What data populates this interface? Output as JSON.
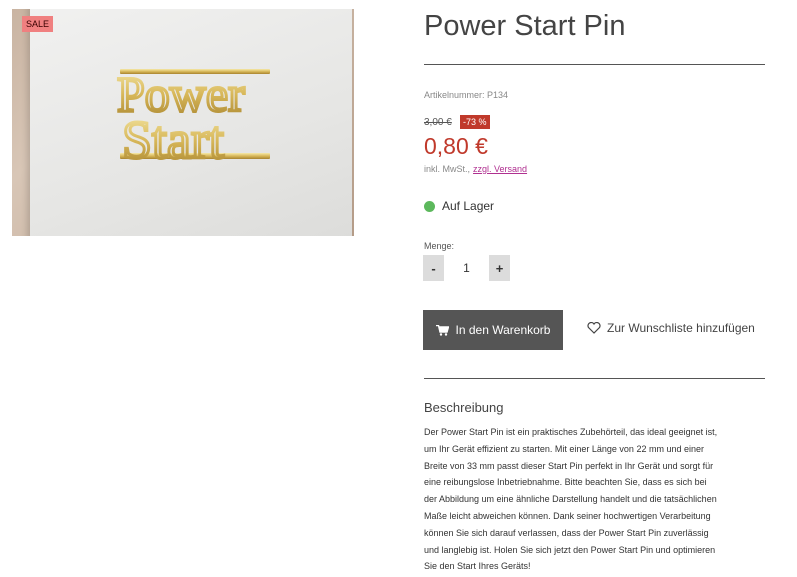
{
  "product": {
    "image_alt": "Power Start Pin",
    "sale_badge": "SALE",
    "pin_line_1": "Power",
    "pin_line_2": "Start",
    "title": "Power Start Pin",
    "sku_label": "Artikelnummer: P134",
    "old_price": "3,00 €",
    "discount": "-73 %",
    "price": "0,80 €",
    "tax_text": "inkl. MwSt.,",
    "shipping_link": "zzgl. Versand",
    "stock_text": "Auf Lager",
    "quantity_label": "Menge:",
    "quantity_value": "1",
    "minus_label": "-",
    "plus_label": "+",
    "add_to_cart_label": "In den Warenkorb",
    "wishlist_label": "Zur Wunschliste hinzufügen",
    "description_heading": "Beschreibung",
    "description_lines": [
      "Der Power Start Pin ist ein praktisches Zubehörteil, das ideal geeignet ist,",
      "um Ihr Gerät effizient zu starten. Mit einer Länge von 22 mm und einer",
      "Breite von 33 mm passt dieser Start Pin perfekt in Ihr Gerät und sorgt für",
      "eine reibungslose Inbetriebnahme. Bitte beachten Sie, dass es sich bei",
      "der Abbildung um eine ähnliche Darstellung handelt und die tatsächlichen",
      "Maße leicht abweichen können. Dank seiner hochwertigen Verarbeitung",
      "können Sie sich darauf verlassen, dass der Power Start Pin zuverlässig",
      "und langlebig ist. Holen Sie sich jetzt den Power Start Pin und optimieren",
      "Sie den Start Ihres Geräts!"
    ]
  },
  "colors": {
    "price_red": "#c0392b",
    "sale_pink": "#f08080",
    "stock_green": "#5cb85c",
    "button_dark": "#555555",
    "link_magenta": "#b03090"
  },
  "icons": {
    "cart": "cart-icon",
    "heart": "heart-outline-icon"
  }
}
